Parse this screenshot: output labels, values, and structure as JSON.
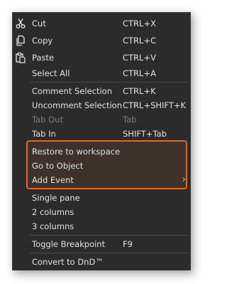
{
  "menu": {
    "items": [
      {
        "label": "Cut",
        "shortcut": "CTRL+X",
        "icon": "scissors-icon"
      },
      {
        "label": "Copy",
        "shortcut": "CTRL+C",
        "icon": "copy-icon"
      },
      {
        "label": "Paste",
        "shortcut": "CTRL+V",
        "icon": "paste-icon"
      },
      {
        "label": "Select All",
        "shortcut": "CTRL+A"
      },
      {
        "label": "Comment Selection",
        "shortcut": "CTRL+K"
      },
      {
        "label": "Uncomment Selection",
        "shortcut": "CTRL+SHIFT+K"
      },
      {
        "label": "Tab Out",
        "shortcut": "Tab",
        "disabled": true
      },
      {
        "label": "Tab In",
        "shortcut": "SHIFT+Tab"
      },
      {
        "label": "Restore to workspace",
        "shortcut": ""
      },
      {
        "label": "Go to Object",
        "shortcut": ""
      },
      {
        "label": "Add Event",
        "shortcut": "",
        "submenu": true
      },
      {
        "label": "Single pane",
        "shortcut": ""
      },
      {
        "label": "2 columns",
        "shortcut": ""
      },
      {
        "label": "3 columns",
        "shortcut": ""
      },
      {
        "label": "Toggle Breakpoint",
        "shortcut": "F9"
      },
      {
        "label": "Convert to DnD™",
        "shortcut": ""
      }
    ],
    "highlight_color": "#e0682c",
    "background_color": "#2b2b2b",
    "text_color": "#e2e2e2",
    "disabled_text_color": "#7f7f7f"
  }
}
